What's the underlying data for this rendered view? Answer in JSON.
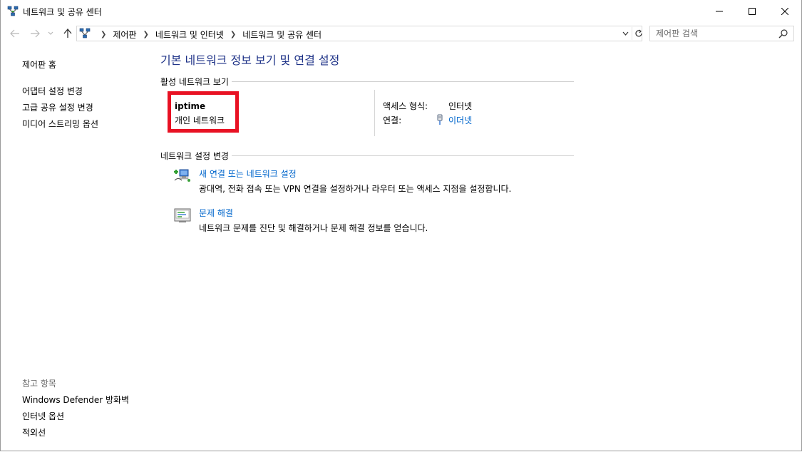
{
  "window": {
    "title": "네트워크 및 공유 센터"
  },
  "address": {
    "crumbs": [
      "제어판",
      "네트워크 및 인터넷",
      "네트워크 및 공유 센터"
    ]
  },
  "search": {
    "placeholder": "제어판 검색",
    "value": ""
  },
  "sidebar": {
    "home_link": "제어판 홈",
    "links": [
      "어댑터 설정 변경",
      "고급 공유 설정 변경",
      "미디어 스트리밍 옵션"
    ],
    "see_also_heading": "참고 항목",
    "see_also": [
      "Windows Defender 방화벽",
      "인터넷 옵션",
      "적외선"
    ]
  },
  "main": {
    "title": "기본 네트워크 정보 보기 및 연결 설정",
    "active_section": "활성 네트워크 보기",
    "network": {
      "name": "iptime",
      "type": "개인 네트워크",
      "access_label": "액세스 형식:",
      "access_value": "인터넷",
      "connection_label": "연결:",
      "connection_value": "이더넷"
    },
    "change_section": "네트워크 설정 변경",
    "tasks": [
      {
        "link": "새 연결 또는 네트워크 설정",
        "desc": "광대역, 전화 접속 또는 VPN 연결을 설정하거나 라우터 또는 액세스 지점을 설정합니다."
      },
      {
        "link": "문제 해결",
        "desc": "네트워크 문제를 진단 및 해결하거나 문제 해결 정보를 얻습니다."
      }
    ]
  },
  "colors": {
    "accent_title": "#1e3287",
    "link": "#0066cc",
    "highlight_box": "#e81123"
  },
  "icons": [
    "network-icon",
    "minimize-icon",
    "maximize-icon",
    "close-icon",
    "back-arrow-icon",
    "forward-arrow-icon",
    "chevron-down-icon",
    "up-arrow-icon",
    "refresh-icon",
    "search-icon",
    "ethernet-icon",
    "new-connection-icon",
    "troubleshoot-icon"
  ]
}
